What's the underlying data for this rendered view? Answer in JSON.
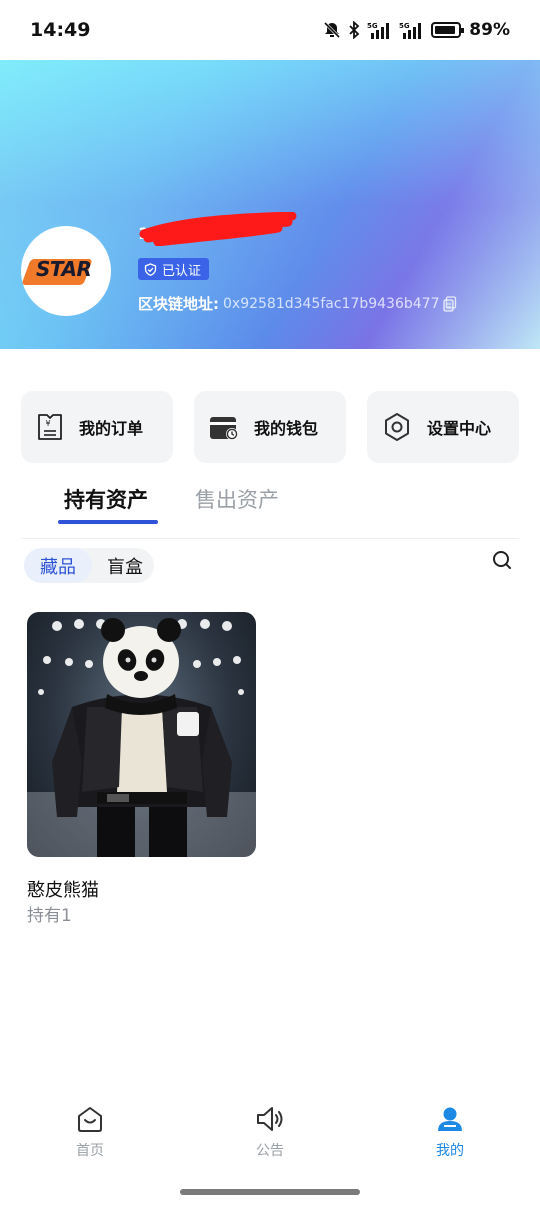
{
  "status_bar": {
    "time": "14:49",
    "battery_percent": "89%",
    "icons": [
      "mute-bell-icon",
      "bluetooth-icon",
      "signal-5g-icon",
      "signal-5g-icon",
      "battery-icon"
    ]
  },
  "profile": {
    "username": "1",
    "verified_label": "已认证",
    "chain_label": "区块链地址:",
    "chain_address": "0x92581d345fac17b9436b477l",
    "avatar_text": "STAR"
  },
  "quick_actions": [
    {
      "label": "我的订单",
      "icon": "order-icon"
    },
    {
      "label": "我的钱包",
      "icon": "wallet-icon"
    },
    {
      "label": "设置中心",
      "icon": "settings-icon"
    }
  ],
  "asset_tabs": {
    "active": "持有资产",
    "inactive": "售出资产"
  },
  "filter": {
    "active": "藏品",
    "inactive": "盲盒"
  },
  "assets": [
    {
      "name": "憨皮熊猫",
      "count": "持有1"
    }
  ],
  "bottom_nav": [
    {
      "label": "首页",
      "icon": "home-icon",
      "active": false
    },
    {
      "label": "公告",
      "icon": "speaker-icon",
      "active": false
    },
    {
      "label": "我的",
      "icon": "user-icon",
      "active": true
    }
  ],
  "colors": {
    "accent": "#2f53d6",
    "nav_active": "#1e88e5",
    "nav_inactive": "#9aa0a6",
    "card_bg": "#f3f4f6"
  }
}
